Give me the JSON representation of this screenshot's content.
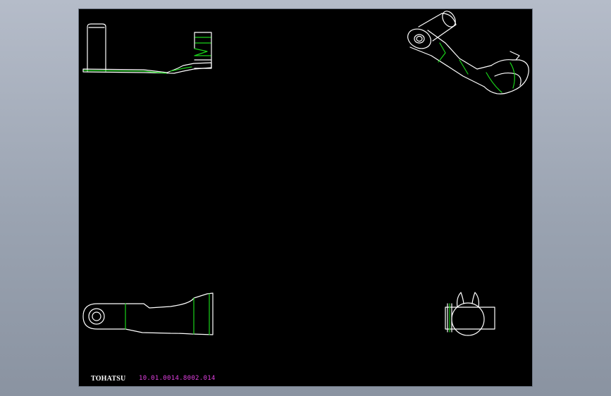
{
  "window": {
    "background_color": "#9aa3b1"
  },
  "drawing": {
    "background_color": "#000000",
    "outline_color": "#ffffff",
    "hidden_edge_color": "#19d219",
    "views": [
      {
        "name": "side-view",
        "position": "top-left"
      },
      {
        "name": "isometric-view",
        "position": "top-right"
      },
      {
        "name": "top-view",
        "position": "bottom-left"
      },
      {
        "name": "end-view",
        "position": "bottom-right"
      }
    ]
  },
  "title_block": {
    "brand": "TOHATSU",
    "brand_color": "#ffffff",
    "part_number": "10.01.0014.8002.014",
    "part_number_color": "#e040e0"
  }
}
